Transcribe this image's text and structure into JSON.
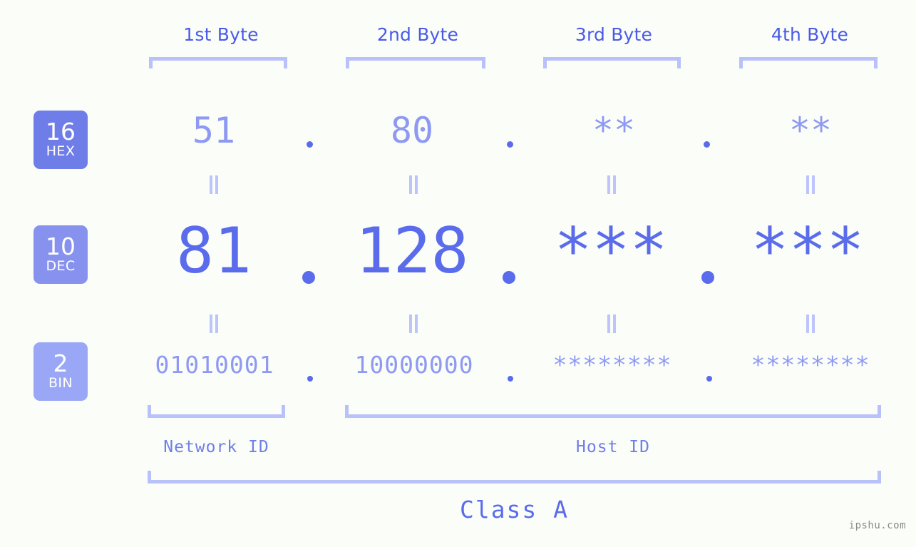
{
  "meta": {
    "background_color": "#fbfdf8",
    "accent_strong": "#5a6ceb",
    "accent_mid": "#8e99f3",
    "accent_light": "#b9c1fb",
    "watermark": "ipshu.com"
  },
  "headers": {
    "bytes": [
      {
        "label": "1st Byte"
      },
      {
        "label": "2nd Byte"
      },
      {
        "label": "3rd Byte"
      },
      {
        "label": "4th Byte"
      }
    ]
  },
  "rows": [
    {
      "badge": {
        "number": "16",
        "name": "HEX",
        "color": "#6f7de9"
      },
      "values": [
        "51",
        "80",
        "**",
        "**"
      ],
      "separators": [
        ".",
        ".",
        "."
      ]
    },
    {
      "badge": {
        "number": "10",
        "name": "DEC",
        "color": "#8792ef"
      },
      "values": [
        "81",
        "128",
        "***",
        "***"
      ],
      "separators": [
        ".",
        ".",
        "."
      ]
    },
    {
      "badge": {
        "number": "2",
        "name": "BIN",
        "color": "#9aa6f6"
      },
      "values": [
        "01010001",
        "10000000",
        "********",
        "********"
      ],
      "separators": [
        ".",
        ".",
        "."
      ]
    }
  ],
  "equality_marks": {
    "symbol": "||",
    "count_per_row_gap": 4
  },
  "footer": {
    "segments": [
      {
        "label": "Network ID"
      },
      {
        "label": "Host ID"
      }
    ],
    "class": {
      "label": "Class A"
    }
  }
}
